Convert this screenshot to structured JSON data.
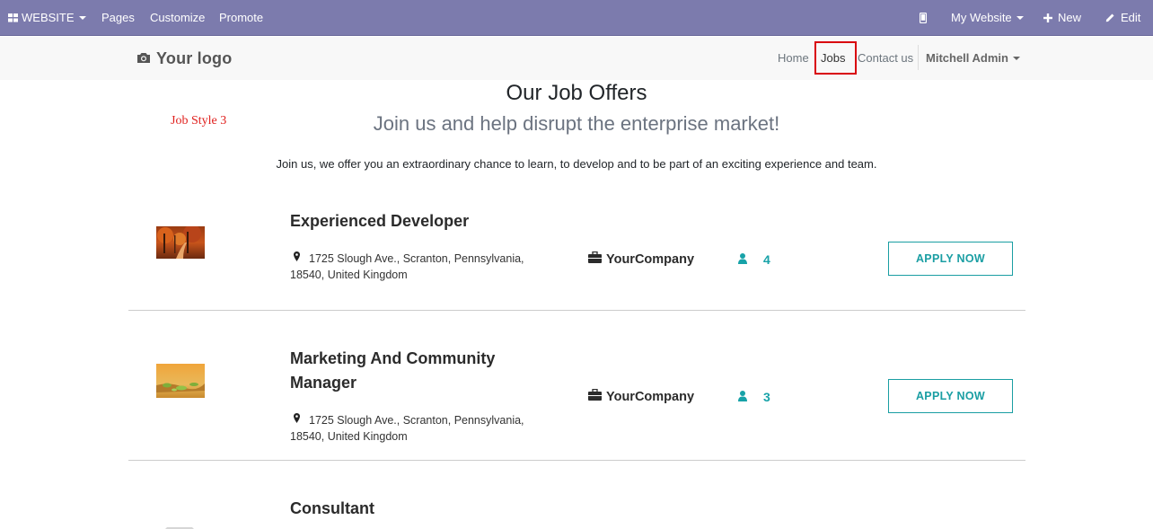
{
  "topbar": {
    "website_label": "WEBSITE",
    "pages": "Pages",
    "customize": "Customize",
    "promote": "Promote",
    "my_website": "My Website",
    "new_label": "New",
    "edit_label": "Edit"
  },
  "navbar": {
    "logo_text": "Your logo",
    "home": "Home",
    "jobs": "Jobs",
    "contact": "Contact us",
    "user": "Mitchell Admin"
  },
  "header": {
    "title": "Our Job Offers",
    "style_label": "Job Style 3",
    "subtitle": "Join us and help disrupt the enterprise market!",
    "intro": "Join us, we offer you an extraordinary chance to learn, to develop and to be part of an exciting experience and team."
  },
  "jobs": [
    {
      "title": "Experienced Developer",
      "address": "1725 Slough Ave., Scranton, Pennsylvania, 18540, United Kingdom",
      "company": "YourCompany",
      "count": "4",
      "apply": "APPLY NOW",
      "thumb": "autumn-forest-image"
    },
    {
      "title": "Marketing And Community Manager",
      "address": "1725 Slough Ave., Scranton, Pennsylvania, 18540, United Kingdom",
      "company": "YourCompany",
      "count": "3",
      "apply": "APPLY NOW",
      "thumb": "sunset-leaves-image"
    },
    {
      "title": "Consultant",
      "thumb": "placeholder-image"
    }
  ],
  "colors": {
    "topbar_bg": "#7c7bad",
    "accent_teal": "#17a2a8",
    "highlight_red": "#d9000d",
    "style_label_red": "#e0201d"
  }
}
